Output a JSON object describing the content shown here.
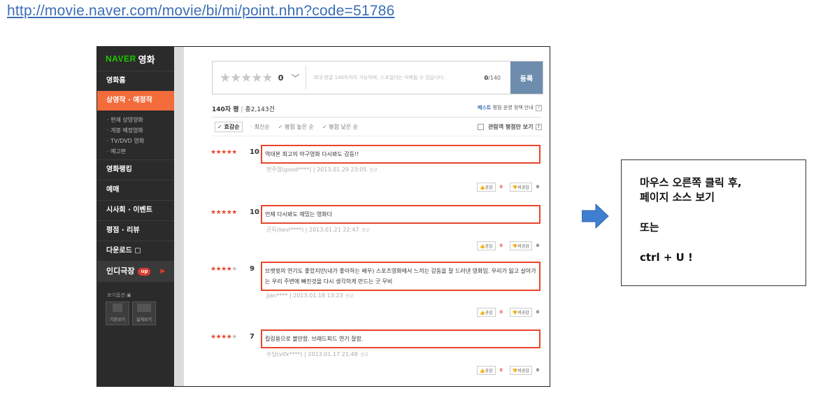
{
  "url": "http://movie.naver.com/movie/bi/mi/point.nhn?code=51786",
  "sidebar": {
    "logo_brand": "NAVER",
    "logo_text": "영화",
    "items": [
      "영화홈",
      "상영작 · 예정작"
    ],
    "sub_items": [
      "· 현재 상영영화",
      "· 개봉 예정영화",
      "· TV/DVD 영화",
      "· 예고편"
    ],
    "items2": [
      "영화랭킹",
      "예매",
      "시사회 · 이벤트",
      "평점 · 리뷰",
      "다운로드 ▢"
    ],
    "indie": "인디극장",
    "indie_badge": "up",
    "view_options": "보기옵션 ▣",
    "view_buttons": [
      "기본보기",
      "넓게보기"
    ]
  },
  "input": {
    "stars": "★★★★★",
    "score": "0",
    "placeholder": "최대 한글 140자까지 가능하며, 스포일러는 삭제될 수 있습니다.",
    "count_current": "0",
    "count_max": "/140",
    "submit_label": "등록"
  },
  "header": {
    "title": "140자 평",
    "divider": "|",
    "total": "총2,143건",
    "policy_best": "베스트",
    "policy_text": "평점 운영 정책 안내",
    "help": "?"
  },
  "sort": {
    "options": [
      "✓ 호감순",
      "· 최신순",
      "✓ 평점 높은 순",
      "✓ 평점 낮은 순"
    ],
    "viewer_only": "관람객 평점만 보기",
    "help": "?"
  },
  "reviews": [
    {
      "stars_on": "★★★★★",
      "stars_off": "",
      "score": "10",
      "text": "역대본 최고의 야구영화 다시봐도 감동!!",
      "author": "전주영(good****)",
      "date": "2013.01.29 23:05",
      "report": "신고",
      "like": "공감",
      "like_count": "0",
      "dislike": "비공감",
      "dislike_count": "0"
    },
    {
      "stars_on": "★★★★★",
      "stars_off": "",
      "score": "10",
      "text": "언제 다시봐도 재밌는 영화다",
      "author": "곤득(kevi****)",
      "date": "2013.01.21 22:47",
      "report": "신고",
      "like": "공감",
      "like_count": "0",
      "dislike": "비공감",
      "dislike_count": "0"
    },
    {
      "stars_on": "★★★★",
      "stars_off": "★",
      "score": "9",
      "text": "브랫핏의 연기도 좋았지만(내가 좋아하는 배우) 스포츠영화에서 느끼는 감동을 잘 드러낸 영화임. 우리가 잃고 살아가는 우리 주변에 빠진것을 다시 생각하게 만드는 굿 무비",
      "author": "jjan****",
      "date": "2013.01.18 13:23",
      "report": "신고",
      "like": "공감",
      "like_count": "0",
      "dislike": "비공감",
      "dislike_count": "0"
    },
    {
      "stars_on": "★★★★",
      "stars_off": "★",
      "score": "7",
      "text": "킬링용으로 볼만함. 브래드피드 연기 잘함.",
      "author": "수딩(vifx****)",
      "date": "2013.01.17 21:48",
      "report": "신고",
      "like": "공감",
      "like_count": "0",
      "dislike": "비공감",
      "dislike_count": "0"
    }
  ],
  "note": {
    "line1": "마우스 오른쪽 클릭 후,",
    "line2": "페이지 소스 보기",
    "line3": "또는",
    "line4": "ctrl + U !"
  },
  "colors": {
    "accent": "#f26c3c",
    "highlight": "#e8452c",
    "arrow": "#3f7fd0",
    "naver_green": "#1ec800"
  }
}
